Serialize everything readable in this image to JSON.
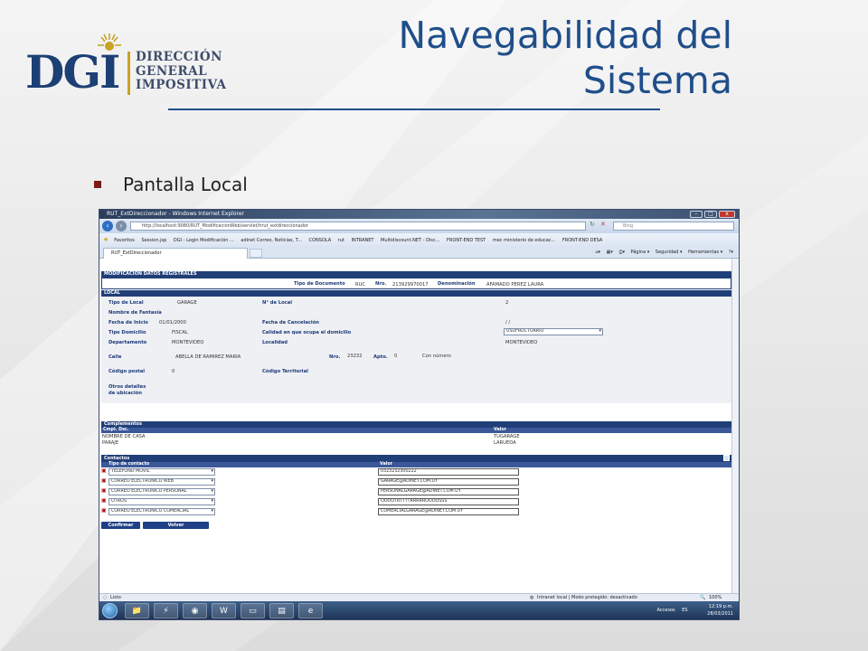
{
  "slide": {
    "title_line1": "Navegabilidad del",
    "title_line2": "Sistema",
    "bullet": "Pantalla Local",
    "logo": {
      "mark": "DGI",
      "line1": "DIRECCIÓN",
      "line2": "GENERAL",
      "line3": "IMPOSITIVA"
    },
    "colors": {
      "title": "#1f4e8a",
      "bullet": "#7a1a1a",
      "logo_blue": "#1c3f74",
      "logo_gold": "#c9a227"
    }
  },
  "browser": {
    "window_title": "RUT_ExtDireccionador - Windows Internet Explorer",
    "address": "http://localhost:9080/RUT_ModificacionWeb/servlet/hrut_extdireccionador",
    "search_placeholder": "Bing",
    "favorites": {
      "label": "Favoritos",
      "items": [
        "Session.jsp",
        "DGI - Login Modificación ...",
        "adinet Correo, Noticias, T...",
        "CONSOLA",
        "rut",
        "INTRANET",
        "Multidiscount.NET - Disc...",
        "FRONT-END TEST",
        "mec ministerio de educac...",
        "FRONT-END DESA"
      ]
    },
    "tab_label": "RUT_ExtDireccionador",
    "cmd": {
      "page": "Página ▾",
      "security": "Seguridad ▾",
      "tools": "Herramientas ▾"
    },
    "status_left": "Listo",
    "status_zone": "Intranet local | Modo protegido: desactivado",
    "zoom": "100%"
  },
  "form": {
    "header": "MODIFICACIÓN DATOS REGISTRALES",
    "tipo_doc_label": "Tipo de Documento",
    "tipo_doc": "RUC",
    "nro_label": "Nro.",
    "nro": "213929970017",
    "denom_label": "Denominación",
    "denominacion": "AFAMADO PEREZ LAURA",
    "local_header": "LOCAL",
    "fields": {
      "tipo_local_label": "Tipo de Local",
      "tipo_local": "GARAGE",
      "n_local_label": "N° de Local",
      "n_local": "2",
      "fantasia_label": "Nombre de Fantasía",
      "inicio_label": "Fecha de Inicio",
      "inicio": "01/01/2000",
      "cancel_label": "Fecha de Cancelación",
      "cancel": "/ /",
      "tipo_dom_label": "Tipo Domicilio",
      "tipo_dom": "FISCAL",
      "calidad_label": "Calidad en que ocupa el domicilio",
      "calidad": "USUFRUCTUARIO",
      "depto_label": "Departamento",
      "depto": "MONTEVIDEO",
      "localidad_label": "Localidad",
      "localidad": "MONTEVIDEO",
      "calle_label": "Calle",
      "calle": "ABELLA DE RAMIREZ MARIA",
      "nro_label": "Nro.",
      "nro": "23232",
      "apto_label": "Apto.",
      "apto": "0",
      "con_numero": "Con número",
      "cp_label": "Código postal",
      "cp": "0",
      "cod_terr_label": "Código Territorial",
      "otros_label_1": "Otros detalles",
      "otros_label_2": "de ubicación"
    },
    "complementos": {
      "header": "Complementos",
      "col1": "Cmpl. Dsc.",
      "col2": "Valor",
      "rows": [
        {
          "desc": "NOMBRE DE CASA",
          "valor": "TUGARAGE"
        },
        {
          "desc": "PARAJE",
          "valor": "LARUEDA"
        }
      ]
    },
    "contactos": {
      "header": "Contactos",
      "col1": "Tipo de contacto",
      "col2": "Valor",
      "rows": [
        {
          "tipo": "TELEFONO MOVIL",
          "valor": "0323232300222"
        },
        {
          "tipo": "CORREO ELECTRONICO WEB",
          "valor": "GARAGE@ADINET.COM.UY"
        },
        {
          "tipo": "CORREO ELECTRONICO PERSONAL",
          "valor": "PERSONALGARAGE@ADINET.COM.UY"
        },
        {
          "tipo": "OTROS",
          "valor": "OOOOTRTTTTRRRRROOOOSSS"
        },
        {
          "tipo": "CORREO ELECTRONICO COMERCIAL",
          "valor": "COMERCIALGARAGE@ADINET.COM.UY"
        }
      ]
    },
    "buttons": {
      "confirm": "Confirmar",
      "back": "Volver"
    }
  },
  "taskbar": {
    "accesos": "Accesos",
    "lang": "ES",
    "time": "12:19 p.m.",
    "date": "28/03/2011"
  }
}
